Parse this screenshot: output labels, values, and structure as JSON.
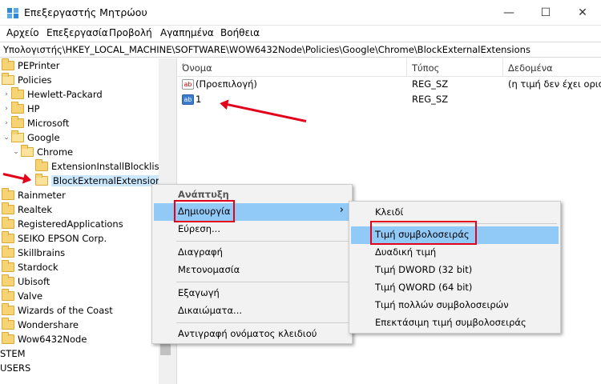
{
  "window": {
    "title": "Επεξεργαστής Μητρώου",
    "controls": {
      "minimize": "—",
      "maximize": "☐",
      "close": "✕"
    }
  },
  "menubar": [
    "Αρχείο",
    "Επεξεργασία",
    "Προβολή",
    "Αγαπημένα",
    "Βοήθεια"
  ],
  "address": "Υπολογιστής\\HKEY_LOCAL_MACHINE\\SOFTWARE\\WOW6432Node\\Policies\\Google\\Chrome\\BlockExternalExtensions",
  "tree": [
    {
      "label": "PEPrinter"
    },
    {
      "label": "Policies"
    },
    {
      "label": "Hewlett-Packard"
    },
    {
      "label": "HP"
    },
    {
      "label": "Microsoft"
    },
    {
      "label": "Google"
    },
    {
      "label": "Chrome"
    },
    {
      "label": "ExtensionInstallBlocklist"
    },
    {
      "label": "BlockExternalExtensions"
    },
    {
      "label": "Rainmeter"
    },
    {
      "label": "Realtek"
    },
    {
      "label": "RegisteredApplications"
    },
    {
      "label": "SEIKO EPSON Corp."
    },
    {
      "label": "Skillbrains"
    },
    {
      "label": "Stardock"
    },
    {
      "label": "Ubisoft"
    },
    {
      "label": "Valve"
    },
    {
      "label": "Wizards of the Coast"
    },
    {
      "label": "Wondershare"
    },
    {
      "label": "Wow6432Node"
    },
    {
      "label": "STEM"
    },
    {
      "label": "USERS"
    }
  ],
  "columns": {
    "name": "Όνομα",
    "type": "Τύπος",
    "data": "Δεδομένα"
  },
  "values": [
    {
      "name": "(Προεπιλογή)",
      "type": "REG_SZ",
      "data": "(η τιμή δεν έχει οριστεί)",
      "icon": "string-value-icon"
    },
    {
      "name": "1",
      "type": "REG_SZ",
      "data": "",
      "icon": "string-value-icon-selected"
    }
  ],
  "context_menu": {
    "items": [
      "Ανάπτυξη",
      "Δημιουργία",
      "Εύρεση...",
      "Διαγραφή",
      "Μετονομασία",
      "Εξαγωγή",
      "Δικαιώματα...",
      "Αντιγραφή ονόματος κλειδιού"
    ],
    "submenu_arrow": "›"
  },
  "submenu": {
    "items": [
      "Κλειδί",
      "Τιμή συμβολοσειράς",
      "Δυαδική τιμή",
      "Τιμή DWORD (32 bit)",
      "Τιμή QWORD (64 bit)",
      "Τιμή πολλών συμβολοσειρών",
      "Επεκτάσιμη τιμή συμβολοσειράς"
    ]
  },
  "icons": {
    "string_value_red": "ab",
    "string_value_blue": "ab"
  },
  "colors": {
    "highlight": "#91c9f7",
    "selection": "#cce8ff",
    "annotation_red": "#e3001b"
  }
}
